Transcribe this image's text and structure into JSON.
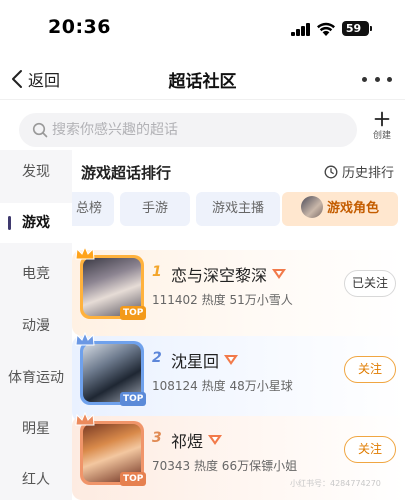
{
  "status_bar": {
    "time": "20:36",
    "battery": "59"
  },
  "nav": {
    "back_label": "返回",
    "title": "超话社区"
  },
  "search": {
    "placeholder": "搜索你感兴趣的超话"
  },
  "create": {
    "label": "创建"
  },
  "sidebar": {
    "items": [
      {
        "label": "发现",
        "active": false
      },
      {
        "label": "游戏",
        "active": true
      },
      {
        "label": "电竞",
        "active": false
      },
      {
        "label": "动漫",
        "active": false
      },
      {
        "label": "体育运动",
        "active": false
      },
      {
        "label": "明星",
        "active": false
      },
      {
        "label": "红人",
        "active": false
      }
    ]
  },
  "section": {
    "title": "游戏超话排行",
    "history_label": "历史排行"
  },
  "tabs": [
    {
      "label": "总榜",
      "active": false
    },
    {
      "label": "手游",
      "active": false
    },
    {
      "label": "游戏主播",
      "active": false
    },
    {
      "label": "游戏角色",
      "active": true
    }
  ],
  "rankings": [
    {
      "rank": "1",
      "name": "恋与深空黎深",
      "stats": "111402 热度 51万小雪人",
      "follow_label": "已关注",
      "followed": true,
      "badge": "TOP",
      "rank_color": "#f3a52a",
      "frame_color": "#ffb23d"
    },
    {
      "rank": "2",
      "name": "沈星回",
      "stats": "108124 热度 48万小星球",
      "follow_label": "关注",
      "followed": false,
      "badge": "TOP",
      "rank_color": "#5d86d9",
      "frame_color": "#6fa1ec"
    },
    {
      "rank": "3",
      "name": "祁煜",
      "stats": "70343 热度 66万保镖小姐",
      "follow_label": "关注",
      "followed": false,
      "badge": "TOP",
      "rank_color": "#e08a53",
      "frame_color": "#f0956a"
    }
  ],
  "watermark": "小红书号：4284774270"
}
